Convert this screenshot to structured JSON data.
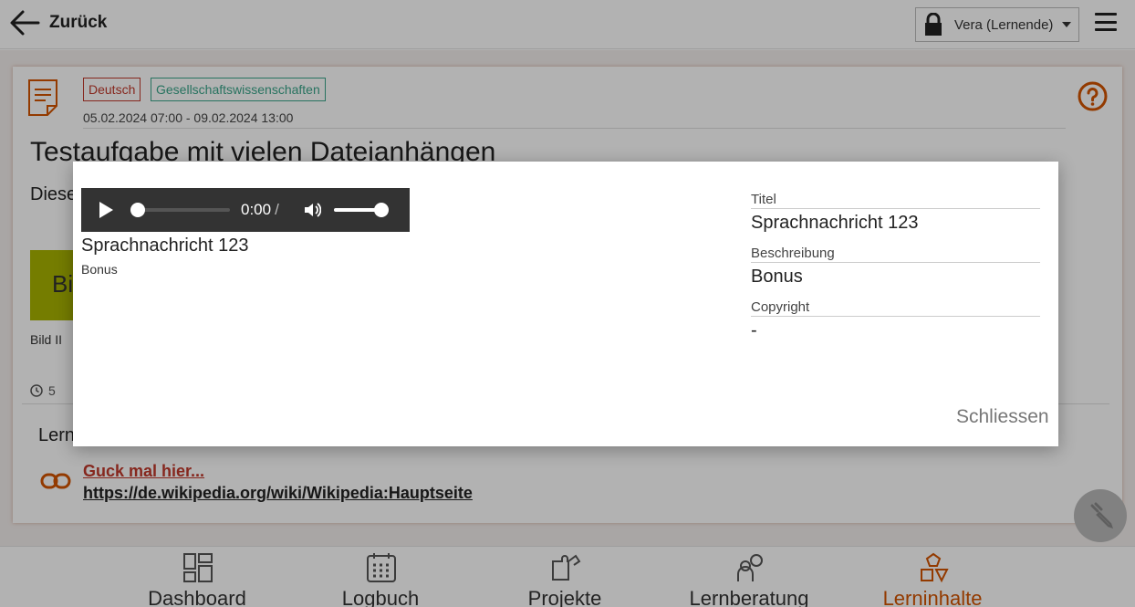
{
  "header": {
    "back_label": "Zurück",
    "user_name": "Vera (Lernende)"
  },
  "task": {
    "tags": [
      "Deutsch",
      "Gesellschaftswissenschaften"
    ],
    "dates": "05.02.2024 07:00 - 09.02.2024 13:00",
    "title": "Testaufgabe mit vielen Dateianhängen",
    "description_partial": "Diese",
    "image_partial": "Bi",
    "image_caption": "Bild II",
    "time_count": "5",
    "section_label_partial": "Lern",
    "link_title": "Guck mal hier...",
    "link_url": "https://de.wikipedia.org/wiki/Wikipedia:Hauptseite"
  },
  "bottom_nav": {
    "items": [
      {
        "label": "Dashboard"
      },
      {
        "label": "Logbuch"
      },
      {
        "label": "Projekte"
      },
      {
        "label": "Lernberatung"
      },
      {
        "label": "Lerninhalte"
      }
    ],
    "active": "Lerninhalte"
  },
  "modal": {
    "player_time": "0:00",
    "player_time_sep": "/",
    "volume_fraction": 1.0,
    "progress_fraction": 0.0,
    "media_title": "Sprachnachricht 123",
    "media_description": "Bonus",
    "fields": [
      {
        "label": "Titel",
        "value": "Sprachnachricht 123"
      },
      {
        "label": "Beschreibung",
        "value": "Bonus"
      },
      {
        "label": "Copyright",
        "value": "-"
      }
    ],
    "close_label": "Schliessen"
  },
  "colors": {
    "accent": "#d35400",
    "tag_deutsch": "#c0392b",
    "tag_gesell": "#3aa58a",
    "player_bg": "#333333"
  }
}
